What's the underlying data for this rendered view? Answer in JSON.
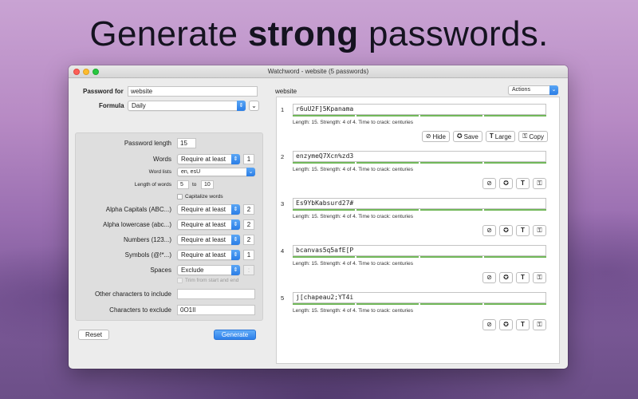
{
  "headline": {
    "normal1": "Generate ",
    "bold": "strong",
    "normal2": " passwords."
  },
  "window": {
    "title": "Watchword - website (5 passwords)"
  },
  "left": {
    "password_for_label": "Password for",
    "password_for_value": "website",
    "formula_label": "Formula",
    "formula_value": "Daily",
    "options": {
      "password_length_label": "Password length",
      "password_length_value": "15",
      "words_label": "Words",
      "words_mode": "Require at least",
      "words_count": "1",
      "word_lists_label": "Word lists",
      "word_lists_value": "en, esU",
      "length_of_words_label": "Length of words",
      "length_min": "5",
      "length_to": "to",
      "length_max": "10",
      "capitalize_words_label": "Capitalize words",
      "alpha_caps_label": "Alpha Capitals (ABC...)",
      "alpha_caps_mode": "Require at least",
      "alpha_caps_count": "2",
      "alpha_lower_label": "Alpha lowercase (abc...)",
      "alpha_lower_mode": "Require at least",
      "alpha_lower_count": "2",
      "numbers_label": "Numbers (123...)",
      "numbers_mode": "Require at least",
      "numbers_count": "2",
      "symbols_label": "Symbols (@!*...)",
      "symbols_mode": "Require at least",
      "symbols_count": "1",
      "spaces_label": "Spaces",
      "spaces_mode": "Exclude",
      "trim_label": "Trim from start and end",
      "other_chars_label": "Other characters to include",
      "other_chars_value": "",
      "exclude_chars_label": "Characters to exclude",
      "exclude_chars_value": "0O1Il"
    },
    "reset_label": "Reset",
    "generate_label": "Generate"
  },
  "right": {
    "header": "website",
    "actions_label": "Actions",
    "strength_text": "Length: 15. Strength: 4 of 4. Time to crack: centuries",
    "buttons": {
      "hide": "Hide",
      "save": "Save",
      "large": "Large",
      "copy": "Copy"
    },
    "entries": [
      {
        "num": "1",
        "password": "r6uU2F]5Kpanama"
      },
      {
        "num": "2",
        "password": "enzymeQ7Xcn%zd3"
      },
      {
        "num": "3",
        "password": "Es9YbKabsurd27#"
      },
      {
        "num": "4",
        "password": "bcanvas5q5afE[P"
      },
      {
        "num": "5",
        "password": "j[chapeau2;YT4i"
      }
    ]
  },
  "icons": {
    "hide": "eye-slash-icon",
    "save": "gear-badge-icon",
    "large": "text-large-icon",
    "copy": "key-copy-icon"
  },
  "colors": {
    "accent": "#2d80ea",
    "meter": "#72b85a"
  }
}
